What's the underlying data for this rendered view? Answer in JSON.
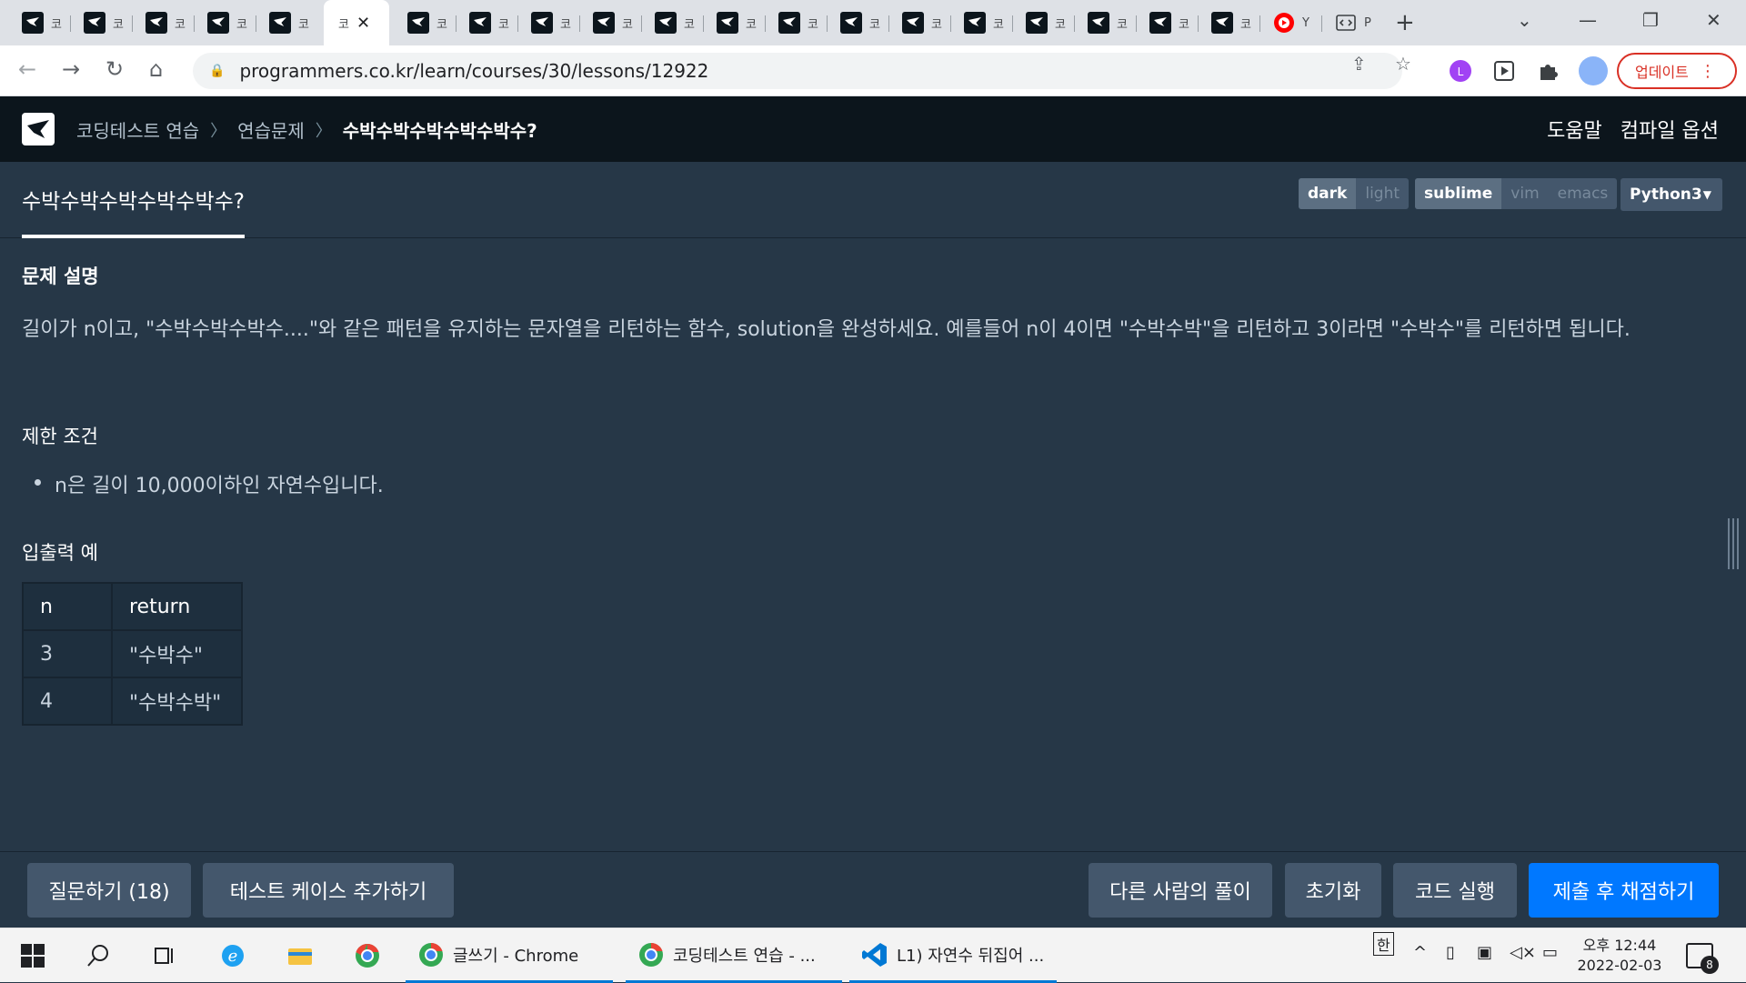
{
  "browser": {
    "active_tab_label": "코",
    "tab_label_fragment": "코",
    "youtube_tab_label": "Y",
    "code_tab_label": "P",
    "url": "programmers.co.kr/learn/courses/30/lessons/12922",
    "update_label": "업데이트"
  },
  "header": {
    "breadcrumbs": [
      "코딩테스트 연습",
      "연습문제",
      "수박수박수박수박수박수?"
    ],
    "help_label": "도움말",
    "compile_options_label": "컴파일 옵션"
  },
  "lessonbar": {
    "title": "수박수박수박수박수박수?",
    "themes": [
      "dark",
      "light"
    ],
    "keymaps": [
      "sublime",
      "vim",
      "emacs"
    ],
    "language": "Python3"
  },
  "problem": {
    "description_heading": "문제 설명",
    "description": "길이가 n이고, \"수박수박수박수....\"와 같은 패턴을 유지하는 문자열을 리턴하는 함수, solution을 완성하세요. 예를들어 n이 4이면 \"수박수박\"을 리턴하고 3이라면 \"수박수\"를 리턴하면 됩니다.",
    "constraints_heading": "제한 조건",
    "constraints": [
      "n은 길이 10,000이하인 자연수입니다."
    ],
    "io_heading": "입출력 예",
    "io_table": {
      "headers": [
        "n",
        "return"
      ],
      "rows": [
        [
          "3",
          "\"수박수\""
        ],
        [
          "4",
          "\"수박수박\""
        ]
      ]
    }
  },
  "actions": {
    "ask": "질문하기 (18)",
    "add_testcase": "테스트 케이스 추가하기",
    "others_solutions": "다른 사람의 풀이",
    "reset": "초기화",
    "run": "코드 실행",
    "submit": "제출 후 채점하기"
  },
  "taskbar": {
    "apps": [
      "글쓰기 - Chrome",
      "코딩테스트 연습 - ...",
      "L1) 자연수 뒤집어 ..."
    ],
    "ime": "한",
    "time": "오후 12:44",
    "date": "2022-02-03",
    "notification_count": "8"
  },
  "colors": {
    "page_bg": "#263747",
    "header_bg": "#0c151c",
    "primary": "#0078ff",
    "update_red": "#d93025"
  }
}
